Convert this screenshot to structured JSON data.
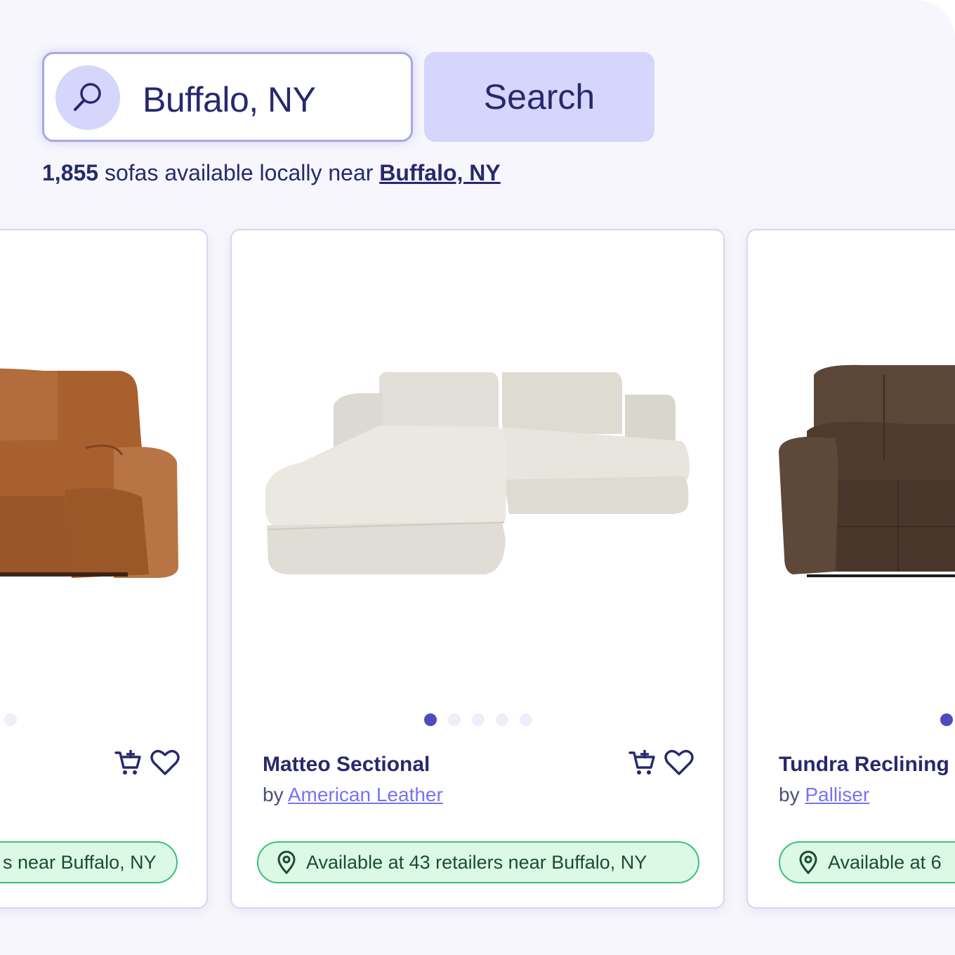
{
  "search": {
    "value": "Buffalo, NY",
    "button_label": "Search"
  },
  "results": {
    "count": "1,855",
    "text": "sofas available locally near",
    "location": "Buffalo, NY"
  },
  "cards": [
    {
      "name": "",
      "by": "",
      "brand": "",
      "availability": "s near Buffalo, NY",
      "image_color": "#b06a3b"
    },
    {
      "name": "Matteo Sectional",
      "by": "by",
      "brand": "American Leather",
      "availability": "Available at 43 retailers near Buffalo, NY",
      "image_color": "#e4e1da"
    },
    {
      "name": "Tundra Reclining",
      "by": "by",
      "brand": "Palliser",
      "availability": "Available at 6",
      "image_color": "#5a4335"
    }
  ],
  "colors": {
    "accent": "#4e4bc0",
    "button_bg": "#d6d5fb",
    "availability_bg": "#dcf9e6",
    "availability_border": "#3cc07a"
  },
  "icons": [
    "search-icon",
    "add-to-cart-icon",
    "heart-icon",
    "location-pin-icon"
  ]
}
